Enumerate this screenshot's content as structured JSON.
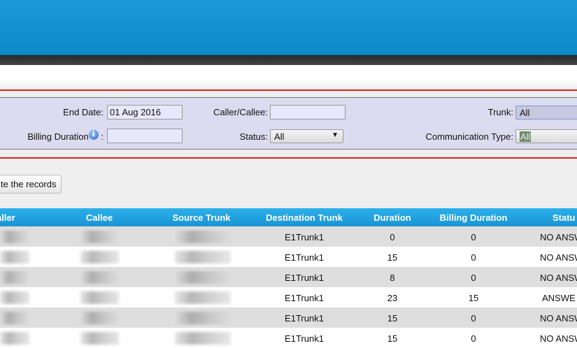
{
  "filters": {
    "end_date_label": "End Date:",
    "end_date_value": "01 Aug 2016",
    "caller_callee_label": "Caller/Callee:",
    "caller_callee_value": "",
    "trunk_label": "Trunk:",
    "trunk_value": "All",
    "billing_duration_label": "Billing Duration",
    "billing_duration_colon": ":",
    "billing_duration_value": "",
    "status_label": "Status:",
    "status_value": "All",
    "communication_type_label": "Communication Type:",
    "communication_type_value": "All"
  },
  "actions": {
    "records_button": "te the records"
  },
  "table": {
    "headers": [
      "aller",
      "Callee",
      "Source Trunk",
      "Destination Trunk",
      "Duration",
      "Billing Duration",
      "Statu"
    ],
    "rows": [
      {
        "dest": "E1Trunk1",
        "duration": "0",
        "billing": "0",
        "status": "NO ANSW"
      },
      {
        "dest": "E1Trunk1",
        "duration": "15",
        "billing": "0",
        "status": "NO ANSW"
      },
      {
        "dest": "E1Trunk1",
        "duration": "8",
        "billing": "0",
        "status": "NO ANSW"
      },
      {
        "dest": "E1Trunk1",
        "duration": "23",
        "billing": "15",
        "status": "ANSWE"
      },
      {
        "dest": "E1Trunk1",
        "duration": "15",
        "billing": "0",
        "status": "NO ANSW"
      },
      {
        "dest": "E1Trunk1",
        "duration": "15",
        "billing": "0",
        "status": "NO ANSW"
      }
    ]
  }
}
